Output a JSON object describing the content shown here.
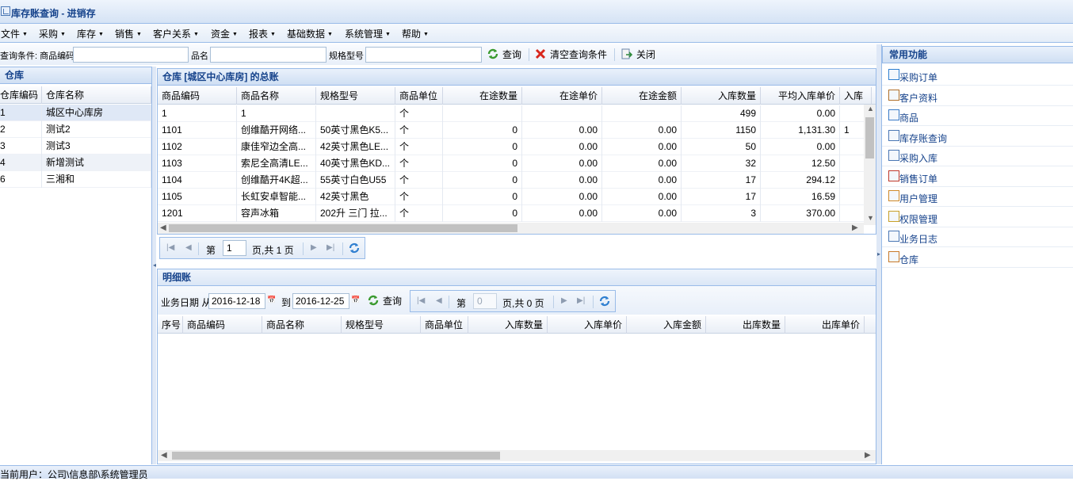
{
  "window": {
    "title": "库存账查询 - 进销存"
  },
  "menu": [
    {
      "label": "文件"
    },
    {
      "label": "采购"
    },
    {
      "label": "库存"
    },
    {
      "label": "销售"
    },
    {
      "label": "客户关系"
    },
    {
      "label": "资金"
    },
    {
      "label": "报表"
    },
    {
      "label": "基础数据"
    },
    {
      "label": "系统管理"
    },
    {
      "label": "帮助"
    }
  ],
  "query": {
    "prefix_label": "查询条件: 商品编码",
    "name_label": "品名",
    "spec_label": "规格型号",
    "code_value": "",
    "name_value": "",
    "spec_value": "",
    "search_label": "查询",
    "clear_label": "清空查询条件",
    "close_label": "关闭"
  },
  "warehouse": {
    "title": "仓库",
    "columns": [
      "仓库编码",
      "仓库名称"
    ],
    "rows": [
      [
        "1",
        "城区中心库房"
      ],
      [
        "2",
        "测试2"
      ],
      [
        "3",
        "测试3"
      ],
      [
        "4",
        "新增测试"
      ],
      [
        "6",
        "三湘和"
      ]
    ],
    "selected_index": 0
  },
  "ledger": {
    "title": "仓库 [城区中心库房] 的总账",
    "columns": [
      "商品编码",
      "商品名称",
      "规格型号",
      "商品单位",
      "在途数量",
      "在途单价",
      "在途金额",
      "入库数量",
      "平均入库单价",
      "入库"
    ],
    "rows": [
      [
        "1",
        "1",
        "",
        "个",
        "",
        "",
        "",
        "499",
        "0.00",
        ""
      ],
      [
        "1101",
        "创维酷开网络...",
        "50英寸黑色K5...",
        "个",
        "0",
        "0.00",
        "0.00",
        "1150",
        "1,131.30",
        "1"
      ],
      [
        "1102",
        "康佳窄边全高...",
        "42英寸黑色LE...",
        "个",
        "0",
        "0.00",
        "0.00",
        "50",
        "0.00",
        ""
      ],
      [
        "1103",
        "索尼全高清LE...",
        "40英寸黑色KD...",
        "个",
        "0",
        "0.00",
        "0.00",
        "32",
        "12.50",
        ""
      ],
      [
        "1104",
        "创维酷开4K超...",
        "55英寸白色U55",
        "个",
        "0",
        "0.00",
        "0.00",
        "17",
        "294.12",
        ""
      ],
      [
        "1105",
        "长虹安卓智能...",
        "42英寸黑色",
        "个",
        "0",
        "0.00",
        "0.00",
        "17",
        "16.59",
        ""
      ],
      [
        "1201",
        "容声冰箱",
        "202升 三门 拉...",
        "个",
        "0",
        "0.00",
        "0.00",
        "3",
        "370.00",
        ""
      ]
    ],
    "pager": {
      "page_prefix": "第",
      "page_value": "1",
      "page_suffix": "页,共 1 页"
    }
  },
  "detail": {
    "title": "明细账",
    "date_label": "业务日期 从",
    "date_from": "2016-12-18",
    "to_label": "到",
    "date_to": "2016-12-25",
    "search_label": "查询",
    "pager": {
      "page_prefix": "第",
      "page_value": "0",
      "page_suffix": "页,共 0 页"
    },
    "columns": [
      "序号",
      "商品编码",
      "商品名称",
      "规格型号",
      "商品单位",
      "入库数量",
      "入库单价",
      "入库金额",
      "出库数量",
      "出库单价"
    ]
  },
  "functions": {
    "title": "常用功能",
    "items": [
      {
        "label": "采购订单",
        "icon": "purchase-order-icon"
      },
      {
        "label": "客户资料",
        "icon": "customer-icon"
      },
      {
        "label": "商品",
        "icon": "goods-icon"
      },
      {
        "label": "库存账查询",
        "icon": "inventory-ledger-icon"
      },
      {
        "label": "采购入库",
        "icon": "purchase-inbound-icon"
      },
      {
        "label": "销售订单",
        "icon": "sales-order-icon"
      },
      {
        "label": "用户管理",
        "icon": "user-management-icon"
      },
      {
        "label": "权限管理",
        "icon": "permission-icon"
      },
      {
        "label": "业务日志",
        "icon": "log-icon"
      },
      {
        "label": "仓库",
        "icon": "warehouse-icon"
      }
    ]
  },
  "status": {
    "text": "当前用户：公司\\信息部\\系统管理员"
  },
  "colors": {
    "accent": "#15428b",
    "border": "#99bbe8",
    "selected_row": "#dfe8f6"
  }
}
